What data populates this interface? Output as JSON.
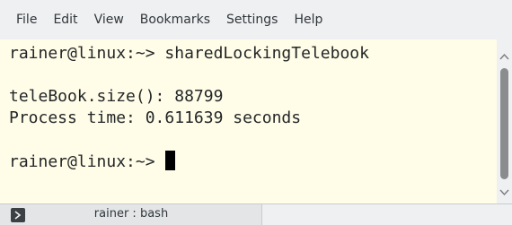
{
  "menubar": {
    "items": [
      "File",
      "Edit",
      "View",
      "Bookmarks",
      "Settings",
      "Help"
    ]
  },
  "terminal": {
    "lines": [
      "rainer@linux:~> sharedLockingTelebook",
      "",
      "teleBook.size(): 88799",
      "Process time: 0.611639 seconds",
      "",
      "rainer@linux:~> "
    ]
  },
  "tabs": [
    {
      "label": "rainer : bash",
      "icon": "terminal-icon"
    }
  ],
  "colors": {
    "terminal_background": "#fffde8",
    "terminal_text": "#232627",
    "chrome_background": "#eff0f1"
  }
}
